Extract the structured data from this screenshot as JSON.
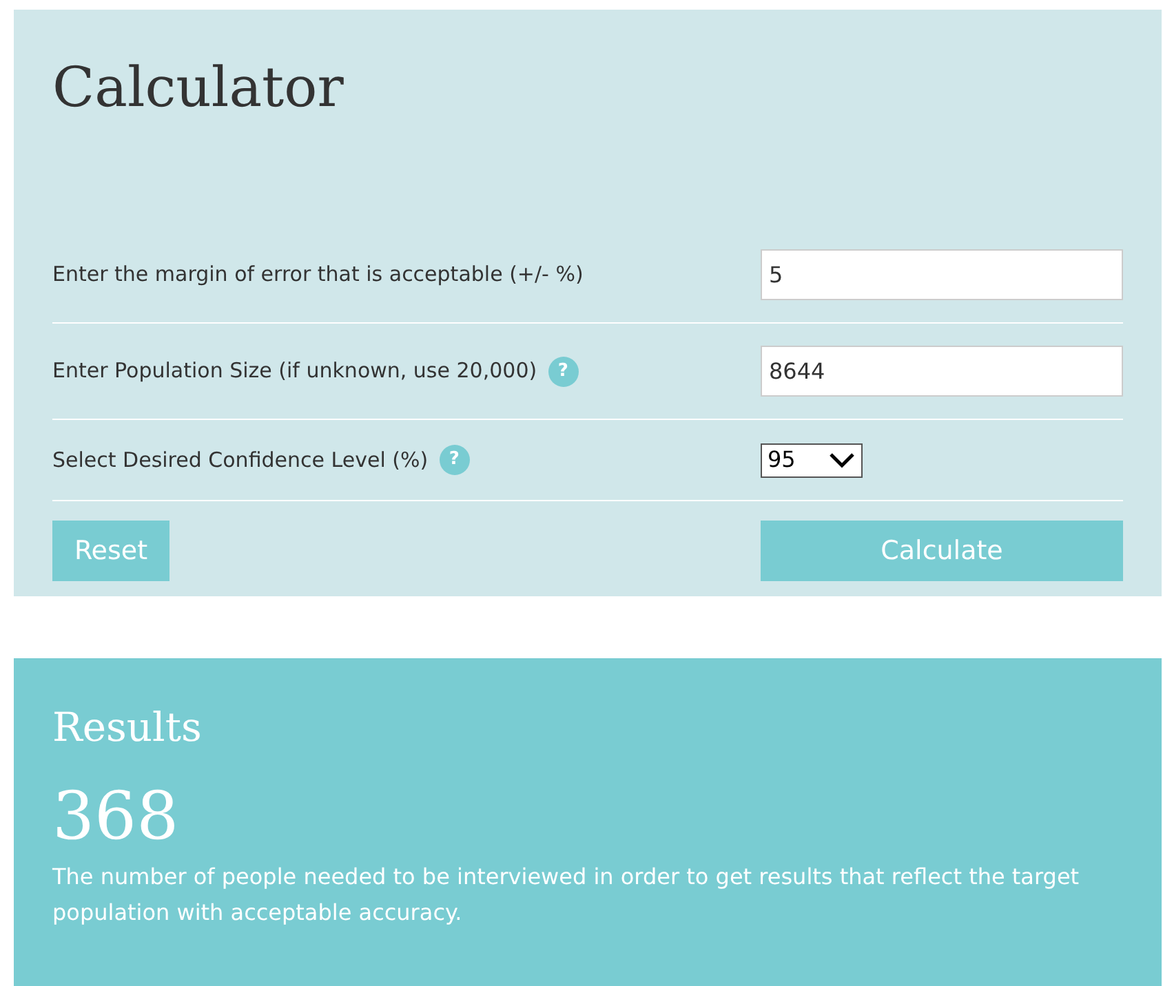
{
  "calculator": {
    "title": "Calculator",
    "fields": [
      {
        "kind": "text",
        "label": "Enter the margin of error that is acceptable (+/- %)",
        "value": "5"
      },
      {
        "kind": "text",
        "label": "Enter Population Size (if unknown, use 20,000)",
        "help": "?",
        "value": "8644"
      },
      {
        "kind": "select",
        "label": "Select Desired Confidence Level (%)",
        "help": "?",
        "value": "95"
      }
    ],
    "buttons": [
      {
        "kind": "reset",
        "label": "Reset"
      },
      {
        "kind": "calculate",
        "label": "Calculate"
      }
    ]
  },
  "results": {
    "title": "Results",
    "value": "368",
    "description": "The number of people needed to be interviewed in order to get results that reflect the target population with acceptable accuracy."
  }
}
